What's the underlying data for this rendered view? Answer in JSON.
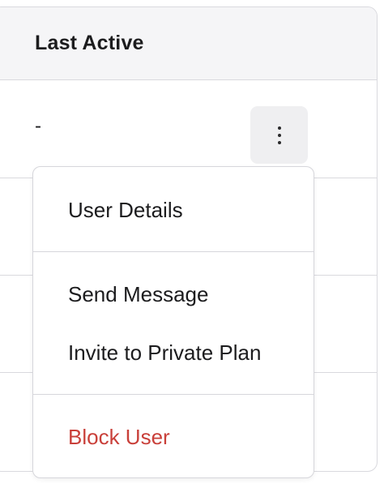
{
  "table": {
    "column_header": "Last Active",
    "rows": [
      {
        "last_active": "-"
      }
    ]
  },
  "row_actions": {
    "icon": "more-vertical-icon"
  },
  "menu": {
    "items": [
      {
        "label": "User Details"
      },
      {
        "label": "Send Message"
      },
      {
        "label": "Invite to Private Plan"
      },
      {
        "label": "Block User"
      }
    ],
    "danger_color": "#c9403a"
  }
}
